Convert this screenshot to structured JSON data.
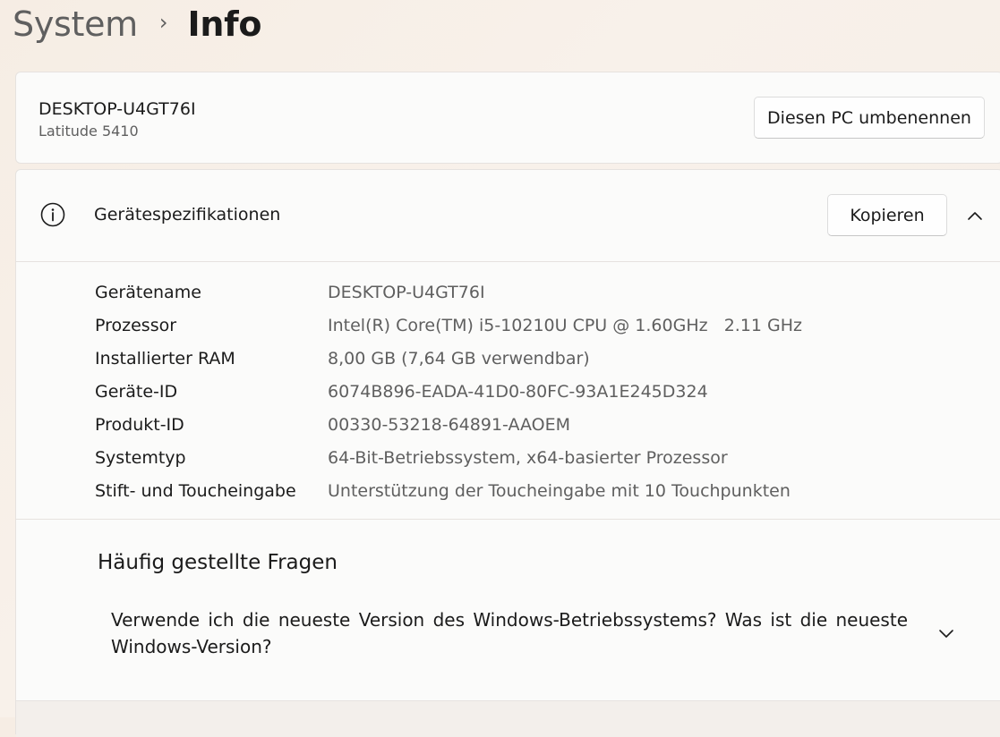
{
  "breadcrumb": {
    "parent": "System",
    "separator": "›",
    "current": "Info"
  },
  "pc": {
    "name": "DESKTOP-U4GT76I",
    "model": "Latitude 5410",
    "rename_label": "Diesen PC umbenennen"
  },
  "specs": {
    "title": "Gerätespezifikationen",
    "copy_label": "Kopieren",
    "icons": {
      "header": "info-icon",
      "collapse": "chevron-up-icon"
    },
    "rows": [
      {
        "label": "Gerätename",
        "value": "DESKTOP-U4GT76I"
      },
      {
        "label": "Prozessor",
        "value": "Intel(R) Core(TM) i5-10210U CPU @ 1.60GHz   2.11 GHz"
      },
      {
        "label": "Installierter RAM",
        "value": "8,00 GB (7,64 GB verwendbar)"
      },
      {
        "label": "Geräte-ID",
        "value": "6074B896-EADA-41D0-80FC-93A1E245D324"
      },
      {
        "label": "Produkt-ID",
        "value": "00330-53218-64891-AAOEM"
      },
      {
        "label": "Systemtyp",
        "value": "64-Bit-Betriebssystem, x64-basierter Prozessor"
      },
      {
        "label": "Stift- und Toucheingabe",
        "value": "Unterstützung der Toucheingabe mit 10 Touchpunkten"
      }
    ]
  },
  "faq": {
    "title": "Häufig gestellte Fragen",
    "items": [
      {
        "question": "Verwende ich die neueste Version des Windows-Betriebssystems? Was ist die neueste Windows-Version?",
        "icon": "chevron-down-icon"
      }
    ]
  },
  "colors": {
    "primary_text": "#1b1b1b",
    "secondary_text": "#5f5f5f",
    "card_bg": "#fbfbfa",
    "window_bg": "#f6ede4"
  }
}
